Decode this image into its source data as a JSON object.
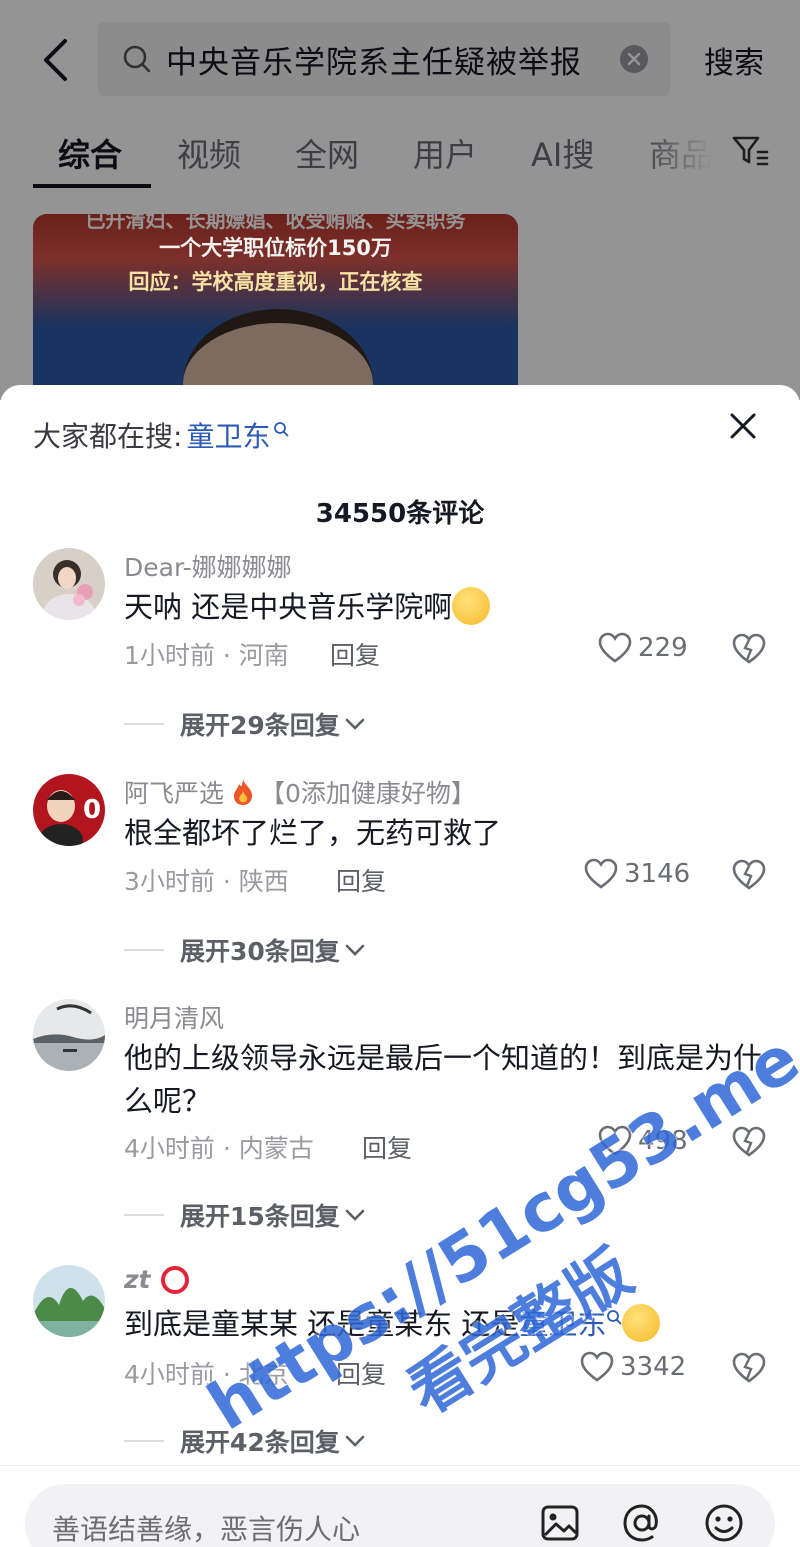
{
  "search": {
    "query": "中央音乐学院系主任疑被举报",
    "button_label": "搜索"
  },
  "tabs": [
    {
      "label": "综合"
    },
    {
      "label": "视频"
    },
    {
      "label": "全网"
    },
    {
      "label": "用户"
    },
    {
      "label": "AI搜"
    },
    {
      "label": "商品"
    }
  ],
  "result_card": {
    "line0": "已升清妇、长期嫖娼、收受贿赂、买卖职务",
    "line1": "一个大学职位标价150万",
    "line2": "回应：学校高度重视，正在核查"
  },
  "sheet": {
    "hot_search_prefix": "大家都在搜:",
    "hot_search_term": "童卫东",
    "comment_count": "34550条评论"
  },
  "comments": [
    {
      "user": "Dear-娜娜娜娜",
      "text": "天呐 还是中央音乐学院啊",
      "time_location": "1小时前 · 河南",
      "reply": "回复",
      "likes": "229",
      "expand": "展开29条回复"
    },
    {
      "user": "阿飞严选",
      "user_suffix": "【0添加健康好物】",
      "text": "根全都坏了烂了，无药可救了",
      "time_location": "3小时前 · 陕西",
      "reply": "回复",
      "likes": "3146",
      "expand": "展开30条回复"
    },
    {
      "user": "明月清风",
      "text": "他的上级领导永远是最后一个知道的！到底是为什么呢？",
      "time_location": "4小时前 · 内蒙古",
      "reply": "回复",
      "likes": "498",
      "expand": "展开15条回复"
    },
    {
      "user": "zt",
      "text_part1": "到底是童某某 还是童某东 还是",
      "text_link": "童卫东",
      "time_location": "4小时前 · 北京",
      "reply": "回复",
      "likes": "3342",
      "expand": "展开42条回复"
    }
  ],
  "input": {
    "placeholder": "善语结善缘，恶言伤人心"
  },
  "watermark": {
    "url": "https://51cg53.me",
    "text": "看完整版"
  },
  "colors": {
    "link": "#2c5bb5",
    "watermark": "#2f68d8",
    "badge_red": "#e2233a"
  }
}
